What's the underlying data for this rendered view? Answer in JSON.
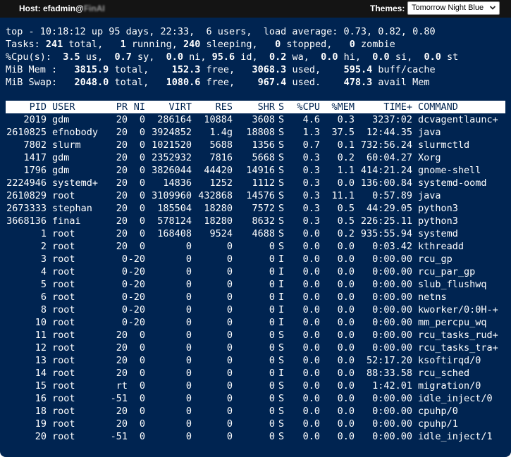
{
  "titlebar": {
    "host_label": "Host: efadmin@",
    "host_suffix": "FinAI",
    "themes_label": "Themes:",
    "theme_selected": "Tomorrow Night Blue"
  },
  "summary": {
    "line1": {
      "prefix": "top - 10:18:12 up 95 days, 22:33,  6 users,  load average: 0.73, 0.82, 0.80"
    },
    "tasks": {
      "label": "Tasks: ",
      "total": "241",
      "total_l": " total,   ",
      "running": "1",
      "running_l": " running, ",
      "sleeping": "240",
      "sleeping_l": " sleeping,   ",
      "stopped": "0",
      "stopped_l": " stopped,   ",
      "zombie": "0",
      "zombie_l": " zombie"
    },
    "cpu": {
      "label": "%Cpu(s):  ",
      "us": "3.5",
      "us_l": " us,  ",
      "sy": "0.7",
      "sy_l": " sy,  ",
      "ni": "0.0",
      "ni_l": " ni, ",
      "id": "95.6",
      "id_l": " id,  ",
      "wa": "0.2",
      "wa_l": " wa,  ",
      "hi": "0.0",
      "hi_l": " hi,  ",
      "si": "0.0",
      "si_l": " si,  ",
      "st": "0.0",
      "st_l": " st"
    },
    "mem": {
      "label": "MiB Mem :   ",
      "total": "3815.9",
      "total_l": " total,    ",
      "free": "152.3",
      "free_l": " free,   ",
      "used": "3068.3",
      "used_l": " used,    ",
      "buff": "595.4",
      "buff_l": " buff/cache"
    },
    "swap": {
      "label": "MiB Swap:   ",
      "total": "2048.0",
      "total_l": " total,   ",
      "free": "1080.6",
      "free_l": " free,    ",
      "used": "967.4",
      "used_l": " used.    ",
      "avail": "478.3",
      "avail_l": " avail Mem"
    }
  },
  "columns": {
    "pid": "PID",
    "user": "USER",
    "pr": "PR",
    "ni": "NI",
    "virt": "VIRT",
    "res": "RES",
    "shr": "SHR",
    "s": "S",
    "cpu": "%CPU",
    "mem": "%MEM",
    "time": "TIME+",
    "command": "COMMAND"
  },
  "processes": [
    {
      "pid": "2019",
      "user": "gdm",
      "pr": "20",
      "ni": "0",
      "virt": "286164",
      "res": "10884",
      "shr": "3608",
      "s": "S",
      "cpu": "4.6",
      "mem": "0.3",
      "time": "3237:02",
      "command": "dcvagentlaunc+"
    },
    {
      "pid": "2610825",
      "user": "efnobody",
      "pr": "20",
      "ni": "0",
      "virt": "3924852",
      "res": "1.4g",
      "shr": "18808",
      "s": "S",
      "cpu": "1.3",
      "mem": "37.5",
      "time": "12:44.35",
      "command": "java"
    },
    {
      "pid": "7802",
      "user": "slurm",
      "pr": "20",
      "ni": "0",
      "virt": "1021520",
      "res": "5688",
      "shr": "1356",
      "s": "S",
      "cpu": "0.7",
      "mem": "0.1",
      "time": "732:56.24",
      "command": "slurmctld"
    },
    {
      "pid": "1417",
      "user": "gdm",
      "pr": "20",
      "ni": "0",
      "virt": "2352932",
      "res": "7816",
      "shr": "5668",
      "s": "S",
      "cpu": "0.3",
      "mem": "0.2",
      "time": "60:04.27",
      "command": "Xorg"
    },
    {
      "pid": "1796",
      "user": "gdm",
      "pr": "20",
      "ni": "0",
      "virt": "3826044",
      "res": "44420",
      "shr": "14916",
      "s": "S",
      "cpu": "0.3",
      "mem": "1.1",
      "time": "414:21.24",
      "command": "gnome-shell"
    },
    {
      "pid": "2224946",
      "user": "systemd+",
      "pr": "20",
      "ni": "0",
      "virt": "14836",
      "res": "1252",
      "shr": "1112",
      "s": "S",
      "cpu": "0.3",
      "mem": "0.0",
      "time": "136:00.84",
      "command": "systemd-oomd"
    },
    {
      "pid": "2610829",
      "user": "root",
      "pr": "20",
      "ni": "0",
      "virt": "3109960",
      "res": "432868",
      "shr": "14576",
      "s": "S",
      "cpu": "0.3",
      "mem": "11.1",
      "time": "0:57.89",
      "command": "java"
    },
    {
      "pid": "2673333",
      "user": "stephan",
      "pr": "20",
      "ni": "0",
      "virt": "185504",
      "res": "18280",
      "shr": "7572",
      "s": "S",
      "cpu": "0.3",
      "mem": "0.5",
      "time": "44:29.05",
      "command": "python3"
    },
    {
      "pid": "3668136",
      "user": "finai",
      "pr": "20",
      "ni": "0",
      "virt": "578124",
      "res": "18280",
      "shr": "8632",
      "s": "S",
      "cpu": "0.3",
      "mem": "0.5",
      "time": "226:25.11",
      "command": "python3"
    },
    {
      "pid": "1",
      "user": "root",
      "pr": "20",
      "ni": "0",
      "virt": "168408",
      "res": "9524",
      "shr": "4688",
      "s": "S",
      "cpu": "0.0",
      "mem": "0.2",
      "time": "935:55.94",
      "command": "systemd"
    },
    {
      "pid": "2",
      "user": "root",
      "pr": "20",
      "ni": "0",
      "virt": "0",
      "res": "0",
      "shr": "0",
      "s": "S",
      "cpu": "0.0",
      "mem": "0.0",
      "time": "0:03.42",
      "command": "kthreadd"
    },
    {
      "pid": "3",
      "user": "root",
      "pr": "0",
      "ni": "-20",
      "virt": "0",
      "res": "0",
      "shr": "0",
      "s": "I",
      "cpu": "0.0",
      "mem": "0.0",
      "time": "0:00.00",
      "command": "rcu_gp"
    },
    {
      "pid": "4",
      "user": "root",
      "pr": "0",
      "ni": "-20",
      "virt": "0",
      "res": "0",
      "shr": "0",
      "s": "I",
      "cpu": "0.0",
      "mem": "0.0",
      "time": "0:00.00",
      "command": "rcu_par_gp"
    },
    {
      "pid": "5",
      "user": "root",
      "pr": "0",
      "ni": "-20",
      "virt": "0",
      "res": "0",
      "shr": "0",
      "s": "I",
      "cpu": "0.0",
      "mem": "0.0",
      "time": "0:00.00",
      "command": "slub_flushwq"
    },
    {
      "pid": "6",
      "user": "root",
      "pr": "0",
      "ni": "-20",
      "virt": "0",
      "res": "0",
      "shr": "0",
      "s": "I",
      "cpu": "0.0",
      "mem": "0.0",
      "time": "0:00.00",
      "command": "netns"
    },
    {
      "pid": "8",
      "user": "root",
      "pr": "0",
      "ni": "-20",
      "virt": "0",
      "res": "0",
      "shr": "0",
      "s": "I",
      "cpu": "0.0",
      "mem": "0.0",
      "time": "0:00.00",
      "command": "kworker/0:0H-+"
    },
    {
      "pid": "10",
      "user": "root",
      "pr": "0",
      "ni": "-20",
      "virt": "0",
      "res": "0",
      "shr": "0",
      "s": "I",
      "cpu": "0.0",
      "mem": "0.0",
      "time": "0:00.00",
      "command": "mm_percpu_wq"
    },
    {
      "pid": "11",
      "user": "root",
      "pr": "20",
      "ni": "0",
      "virt": "0",
      "res": "0",
      "shr": "0",
      "s": "S",
      "cpu": "0.0",
      "mem": "0.0",
      "time": "0:00.00",
      "command": "rcu_tasks_rud+"
    },
    {
      "pid": "12",
      "user": "root",
      "pr": "20",
      "ni": "0",
      "virt": "0",
      "res": "0",
      "shr": "0",
      "s": "S",
      "cpu": "0.0",
      "mem": "0.0",
      "time": "0:00.00",
      "command": "rcu_tasks_tra+"
    },
    {
      "pid": "13",
      "user": "root",
      "pr": "20",
      "ni": "0",
      "virt": "0",
      "res": "0",
      "shr": "0",
      "s": "S",
      "cpu": "0.0",
      "mem": "0.0",
      "time": "52:17.20",
      "command": "ksoftirqd/0"
    },
    {
      "pid": "14",
      "user": "root",
      "pr": "20",
      "ni": "0",
      "virt": "0",
      "res": "0",
      "shr": "0",
      "s": "I",
      "cpu": "0.0",
      "mem": "0.0",
      "time": "88:33.58",
      "command": "rcu_sched"
    },
    {
      "pid": "15",
      "user": "root",
      "pr": "rt",
      "ni": "0",
      "virt": "0",
      "res": "0",
      "shr": "0",
      "s": "S",
      "cpu": "0.0",
      "mem": "0.0",
      "time": "1:42.01",
      "command": "migration/0"
    },
    {
      "pid": "16",
      "user": "root",
      "pr": "-51",
      "ni": "0",
      "virt": "0",
      "res": "0",
      "shr": "0",
      "s": "S",
      "cpu": "0.0",
      "mem": "0.0",
      "time": "0:00.00",
      "command": "idle_inject/0"
    },
    {
      "pid": "18",
      "user": "root",
      "pr": "20",
      "ni": "0",
      "virt": "0",
      "res": "0",
      "shr": "0",
      "s": "S",
      "cpu": "0.0",
      "mem": "0.0",
      "time": "0:00.00",
      "command": "cpuhp/0"
    },
    {
      "pid": "19",
      "user": "root",
      "pr": "20",
      "ni": "0",
      "virt": "0",
      "res": "0",
      "shr": "0",
      "s": "S",
      "cpu": "0.0",
      "mem": "0.0",
      "time": "0:00.00",
      "command": "cpuhp/1"
    },
    {
      "pid": "20",
      "user": "root",
      "pr": "-51",
      "ni": "0",
      "virt": "0",
      "res": "0",
      "shr": "0",
      "s": "S",
      "cpu": "0.0",
      "mem": "0.0",
      "time": "0:00.00",
      "command": "idle_inject/1"
    }
  ],
  "colors": {
    "terminal_bg": "#002451",
    "terminal_fg": "#ffffff",
    "titlebar_bg": "#141414"
  }
}
